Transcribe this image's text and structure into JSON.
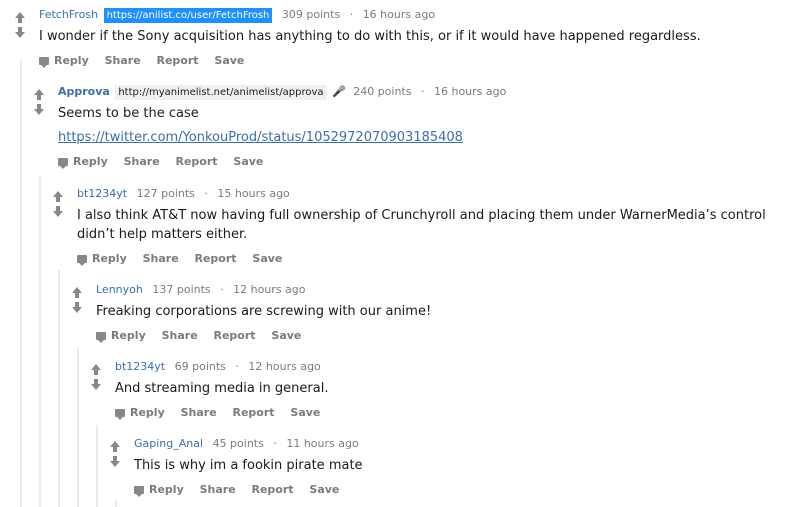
{
  "actions": {
    "reply": "Reply",
    "share": "Share",
    "report": "Report",
    "save": "Save"
  },
  "comments": [
    {
      "author": "FetchFrosh",
      "flair": "https://anilist.co/user/FetchFrosh",
      "points": "309 points",
      "time": "16 hours ago",
      "text": "I wonder if the Sony acquisition has anything to do with this, or if it would have happened regardless."
    },
    {
      "author": "Approva",
      "flair": "http://myanimelist.net/animelist/approva",
      "points": "240 points",
      "time": "16 hours ago",
      "text": "Seems to be the case",
      "link": "https://twitter.com/YonkouProd/status/1052972070903185408"
    },
    {
      "author": "bt1234yt",
      "points": "127 points",
      "time": "15 hours ago",
      "text": "I also think AT&T now having full ownership of Crunchyroll and placing them under WarnerMedia’s control didn’t help matters either."
    },
    {
      "author": "Lennyoh",
      "points": "137 points",
      "time": "12 hours ago",
      "text": "Freaking corporations are screwing with our anime!"
    },
    {
      "author": "bt1234yt",
      "points": "69 points",
      "time": "12 hours ago",
      "text": "And streaming media in general."
    },
    {
      "author": "Gaping_Anal",
      "points": "45 points",
      "time": "11 hours ago",
      "text": "This is why im a fookin pirate mate"
    }
  ]
}
